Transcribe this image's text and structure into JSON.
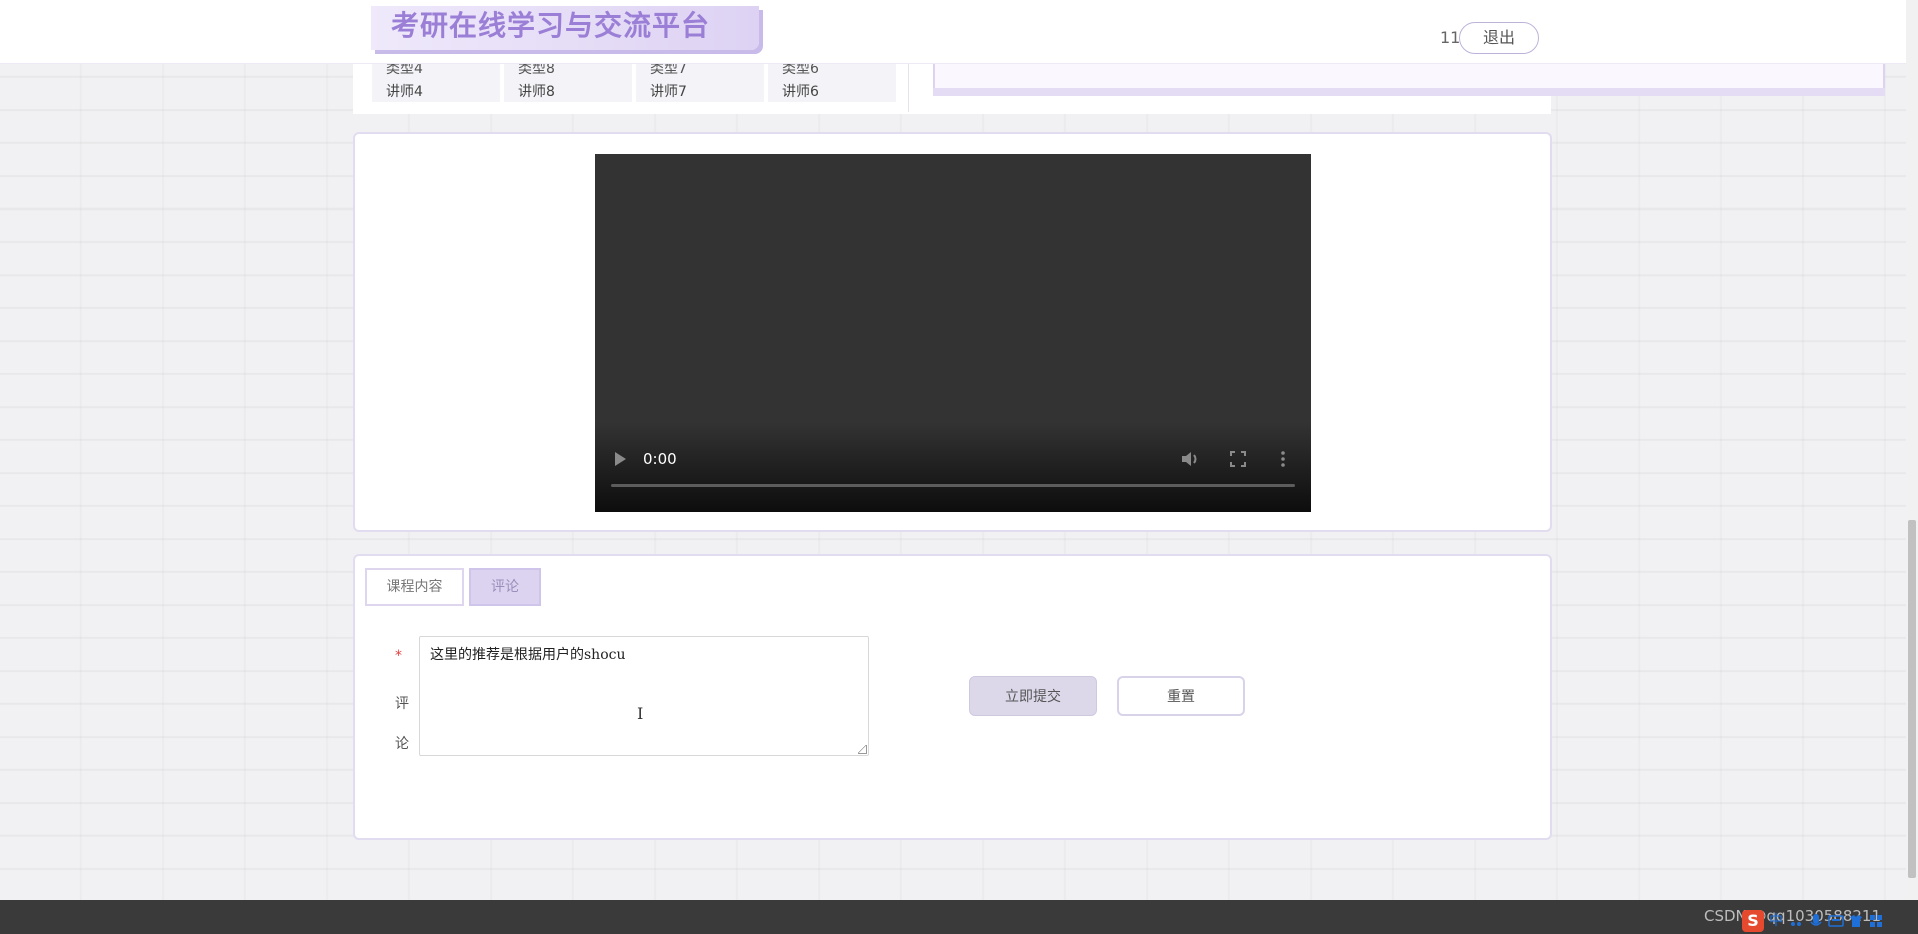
{
  "header": {
    "site_title": "考研在线学习与交流平台",
    "username": "11",
    "logout_label": "退出"
  },
  "upper_section": {
    "teachers": [
      {
        "type": "类型4",
        "teacher": "讲师4"
      },
      {
        "type": "类型8",
        "teacher": "讲师8"
      },
      {
        "type": "类型7",
        "teacher": "讲师7"
      },
      {
        "type": "类型6",
        "teacher": "讲师6"
      }
    ]
  },
  "video": {
    "current_time": "0:00",
    "progress": 0
  },
  "tabs": [
    {
      "label": "课程内容",
      "active": false
    },
    {
      "label": "评论",
      "active": true
    }
  ],
  "comment_form": {
    "required_mark": "*",
    "label": "评论",
    "value": "这里的推荐是根据用户的shocu",
    "submit_label": "立即提交",
    "reset_label": "重置"
  },
  "footer": {
    "watermark": "CSDN @qq1030588211",
    "ime_logo": "S",
    "ime_mode": "中"
  },
  "colors": {
    "accent": "#9b7fd6",
    "accent_light": "#dcd3f0",
    "required": "#e3413f",
    "footer_bg": "#3a3a3a"
  },
  "icons": [
    "play-icon",
    "mute-icon",
    "fullscreen-icon",
    "more-icon",
    "text-cursor-icon",
    "sogou-ime-icon"
  ]
}
